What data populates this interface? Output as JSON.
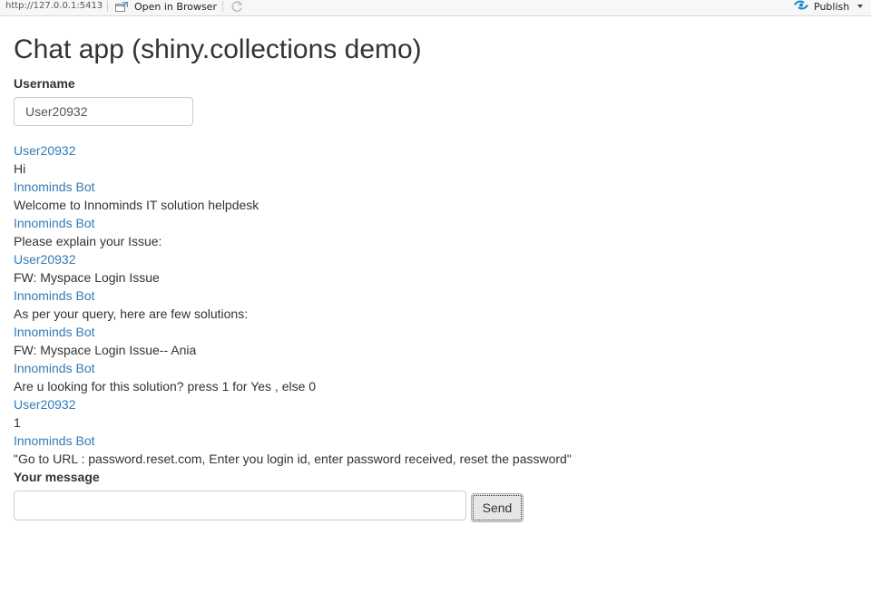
{
  "toolbar": {
    "url": "http://127.0.0.1:5413",
    "open_in_browser": "Open in Browser",
    "publish": "Publish"
  },
  "page": {
    "title": "Chat app (shiny.collections demo)"
  },
  "username": {
    "label": "Username",
    "value": "User20932"
  },
  "chat": {
    "messages": [
      {
        "author": "User20932",
        "text": "Hi"
      },
      {
        "author": "Innominds Bot",
        "text": "Welcome to Innominds IT solution helpdesk"
      },
      {
        "author": "Innominds Bot",
        "text": "Please explain your Issue:"
      },
      {
        "author": "User20932",
        "text": "FW: Myspace Login Issue"
      },
      {
        "author": "Innominds Bot",
        "text": "As per your query, here are few solutions:"
      },
      {
        "author": "Innominds Bot",
        "text": "FW: Myspace Login Issue-- Ania"
      },
      {
        "author": "Innominds Bot",
        "text": "Are u looking for this solution? press 1 for Yes , else 0"
      },
      {
        "author": "User20932",
        "text": "1"
      },
      {
        "author": "Innominds Bot",
        "text": "\"Go to URL : password.reset.com, Enter you login id, enter password received, reset the password\""
      }
    ]
  },
  "message": {
    "label": "Your message",
    "value": "",
    "send_label": "Send"
  },
  "colors": {
    "link": "#337ab7",
    "text": "#333333",
    "publish_icon": "#1a86c8"
  },
  "icons": {
    "open_in_browser": "browser-window-icon",
    "refresh": "refresh-icon",
    "publish": "publish-icon",
    "dropdown": "chevron-down-icon"
  }
}
